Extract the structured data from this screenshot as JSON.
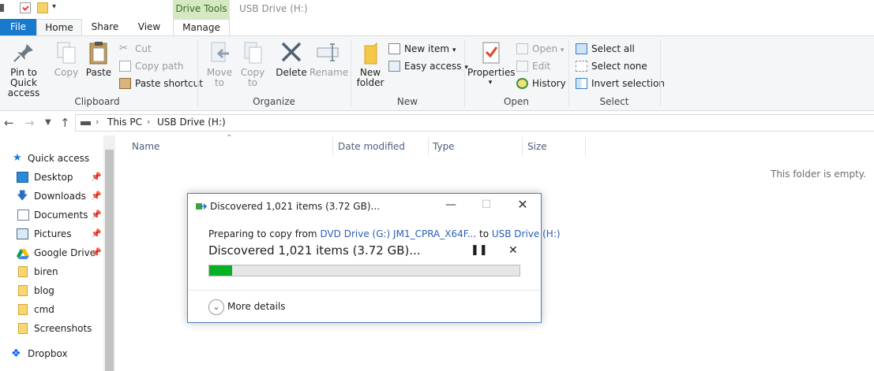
{
  "window": {
    "title": "USB Drive (H:)",
    "context_tab": "Drive Tools"
  },
  "tabs": [
    "File",
    "Home",
    "Share",
    "View",
    "Manage"
  ],
  "ribbon": {
    "clipboard": {
      "label": "Clipboard",
      "pin_line1": "Pin to Quick",
      "pin_line2": "access",
      "copy": "Copy",
      "paste": "Paste",
      "cut": "Cut",
      "copy_path": "Copy path",
      "paste_shortcut": "Paste shortcut"
    },
    "organize": {
      "label": "Organize",
      "move_line1": "Move",
      "move_line2": "to",
      "copy_line1": "Copy",
      "copy_line2": "to",
      "delete": "Delete",
      "rename": "Rename"
    },
    "new": {
      "label": "New",
      "folder_line1": "New",
      "folder_line2": "folder",
      "new_item": "New item",
      "easy_access": "Easy access"
    },
    "open": {
      "label": "Open",
      "properties": "Properties",
      "open": "Open",
      "edit": "Edit",
      "history": "History"
    },
    "select": {
      "label": "Select",
      "select_all": "Select all",
      "select_none": "Select none",
      "invert": "Invert selection"
    }
  },
  "address": {
    "crumbs": [
      "This PC",
      "USB Drive (H:)"
    ]
  },
  "nav": {
    "items": [
      {
        "label": "Quick access",
        "icon": "star-icon"
      },
      {
        "label": "Desktop",
        "icon": "desktop-icon",
        "pinned": true
      },
      {
        "label": "Downloads",
        "icon": "download-icon",
        "pinned": true
      },
      {
        "label": "Documents",
        "icon": "documents-icon",
        "pinned": true
      },
      {
        "label": "Pictures",
        "icon": "pictures-icon",
        "pinned": true
      },
      {
        "label": "Google Drive",
        "icon": "google-drive-icon",
        "pinned": true
      },
      {
        "label": "biren",
        "icon": "folder-icon"
      },
      {
        "label": "blog",
        "icon": "folder-icon"
      },
      {
        "label": "cmd",
        "icon": "folder-icon"
      },
      {
        "label": "Screenshots",
        "icon": "folder-icon"
      },
      {
        "label": "Dropbox",
        "icon": "dropbox-icon"
      }
    ]
  },
  "content": {
    "columns": [
      "Name",
      "Date modified",
      "Type",
      "Size"
    ],
    "empty_message": "This folder is empty."
  },
  "dialog": {
    "title": "Discovered 1,021 items (3.72 GB)...",
    "prefix": "Preparing to copy from ",
    "source": "DVD Drive (G:) JM1_CPRA_X64F...",
    "to": " to ",
    "destination": "USB Drive (H:)",
    "status": "Discovered 1,021 items (3.72 GB)...",
    "progress": 0.075,
    "more_details": "More details",
    "accent": "#06b025"
  }
}
